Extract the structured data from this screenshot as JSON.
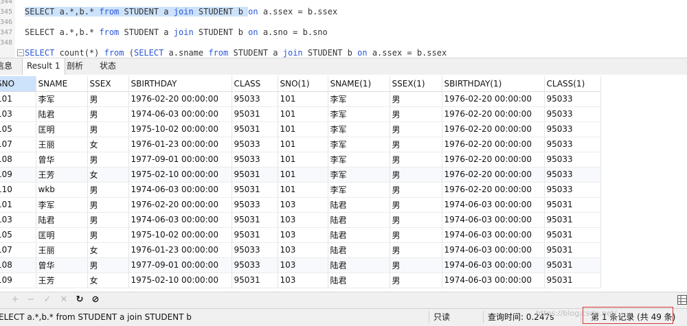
{
  "editor": {
    "line_numbers": [
      "344",
      "345",
      "346",
      "347",
      "348"
    ],
    "line1": {
      "p1": "SELECT a.*,b.* ",
      "k1": "from",
      "p2": " STUDENT a ",
      "k2": "join",
      "p3": " STUDENT b ",
      "k3": "on",
      "p4": " a.ssex = b.ssex"
    },
    "line2": {
      "p1": "SELECT a.*,b.* ",
      "k1": "from",
      "p2": " STUDENT a ",
      "k2": "join",
      "p3": " STUDENT b ",
      "k3": "on",
      "p4": " a.sno = b.sno"
    },
    "line3": {
      "k0": "SELECT",
      "p1": " count(*) ",
      "k1": "from",
      "p2": " (",
      "k2": "SELECT",
      "p3": " a.sname ",
      "k3": "from",
      "p4": " STUDENT a ",
      "k4": "join",
      "p5": " STUDENT b ",
      "k5": "on",
      "p6": " a.ssex = b.ssex"
    },
    "fold_symbol": "−"
  },
  "tabs": [
    "信息",
    "Result 1",
    "剖析",
    "状态"
  ],
  "table": {
    "columns": [
      "SNO",
      "SNAME",
      "SSEX",
      "SBIRTHDAY",
      "CLASS",
      "SNO(1)",
      "SNAME(1)",
      "SSEX(1)",
      "SBIRTHDAY(1)",
      "CLASS(1)"
    ],
    "rows": [
      [
        "101",
        "李军",
        "男",
        "1976-02-20 00:00:00",
        "95033",
        "101",
        "李军",
        "男",
        "1976-02-20 00:00:00",
        "95033"
      ],
      [
        "103",
        "陆君",
        "男",
        "1974-06-03 00:00:00",
        "95031",
        "101",
        "李军",
        "男",
        "1976-02-20 00:00:00",
        "95033"
      ],
      [
        "105",
        "匡明",
        "男",
        "1975-10-02 00:00:00",
        "95031",
        "101",
        "李军",
        "男",
        "1976-02-20 00:00:00",
        "95033"
      ],
      [
        "107",
        "王丽",
        "女",
        "1976-01-23 00:00:00",
        "95033",
        "101",
        "李军",
        "男",
        "1976-02-20 00:00:00",
        "95033"
      ],
      [
        "108",
        "曾华",
        "男",
        "1977-09-01 00:00:00",
        "95033",
        "101",
        "李军",
        "男",
        "1976-02-20 00:00:00",
        "95033"
      ],
      [
        "109",
        "王芳",
        "女",
        "1975-02-10 00:00:00",
        "95031",
        "101",
        "李军",
        "男",
        "1976-02-20 00:00:00",
        "95033"
      ],
      [
        "110",
        "wkb",
        "男",
        "1974-06-03 00:00:00",
        "95031",
        "101",
        "李军",
        "男",
        "1976-02-20 00:00:00",
        "95033"
      ],
      [
        "101",
        "李军",
        "男",
        "1976-02-20 00:00:00",
        "95033",
        "103",
        "陆君",
        "男",
        "1974-06-03 00:00:00",
        "95031"
      ],
      [
        "103",
        "陆君",
        "男",
        "1974-06-03 00:00:00",
        "95031",
        "103",
        "陆君",
        "男",
        "1974-06-03 00:00:00",
        "95031"
      ],
      [
        "105",
        "匡明",
        "男",
        "1975-10-02 00:00:00",
        "95031",
        "103",
        "陆君",
        "男",
        "1974-06-03 00:00:00",
        "95031"
      ],
      [
        "107",
        "王丽",
        "女",
        "1976-01-23 00:00:00",
        "95033",
        "103",
        "陆君",
        "男",
        "1974-06-03 00:00:00",
        "95031"
      ],
      [
        "108",
        "曾华",
        "男",
        "1977-09-01 00:00:00",
        "95033",
        "103",
        "陆君",
        "男",
        "1974-06-03 00:00:00",
        "95031"
      ],
      [
        "109",
        "王芳",
        "女",
        "1975-02-10 00:00:00",
        "95031",
        "103",
        "陆君",
        "男",
        "1974-06-03 00:00:00",
        "95031"
      ]
    ]
  },
  "toolbar": {
    "buttons": [
      {
        "name": "add-record-button",
        "icon": "plus-icon",
        "glyph": "+",
        "enabled": false
      },
      {
        "name": "delete-record-button",
        "icon": "minus-icon",
        "glyph": "−",
        "enabled": false
      },
      {
        "name": "apply-changes-button",
        "icon": "check-icon",
        "glyph": "✓",
        "enabled": false
      },
      {
        "name": "discard-changes-button",
        "icon": "cross-icon",
        "glyph": "✕",
        "enabled": false
      },
      {
        "name": "refresh-button",
        "icon": "refresh-icon",
        "glyph": "↻",
        "enabled": true
      },
      {
        "name": "stop-button",
        "icon": "stop-icon",
        "glyph": "⊘",
        "enabled": true
      }
    ]
  },
  "status": {
    "query": "ELECT a.*,b.* from STUDENT a join STUDENT b",
    "mode": "只读",
    "query_time": "查询时间: 0.247s",
    "records": "第 1 条记录 (共 49 条)",
    "watermark": "https://blog.csdn.net/"
  },
  "colors": {
    "keyword": "#2a55d8",
    "selection": "#cde2fb",
    "records_highlight_border": "#d83434"
  }
}
